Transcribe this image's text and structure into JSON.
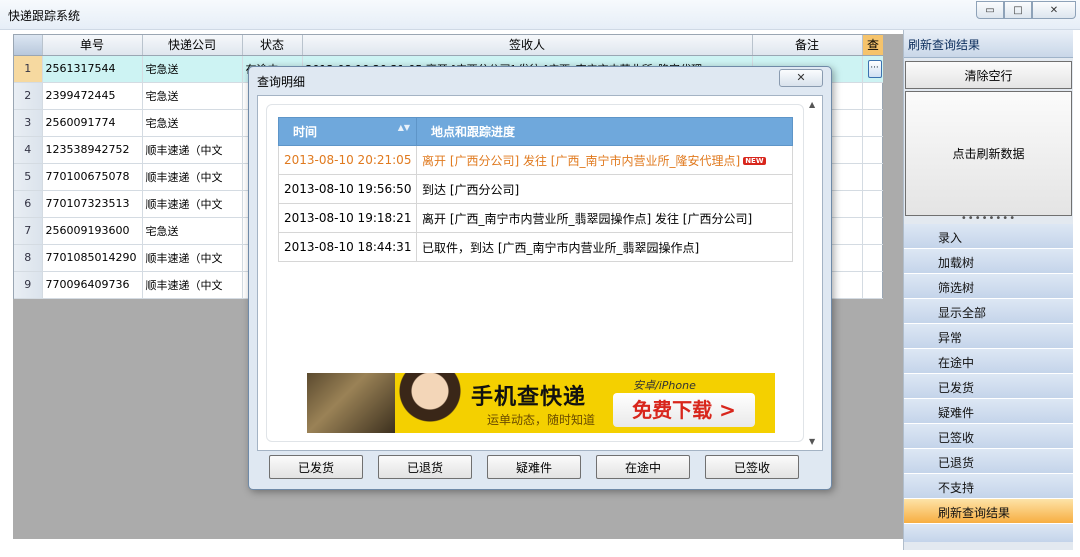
{
  "window": {
    "title": "快递跟踪系统",
    "min_glyph": "▭",
    "max_glyph": "□",
    "close_glyph": "✕"
  },
  "grid": {
    "columns": [
      "单号",
      "快递公司",
      "状态",
      "签收人",
      "备注",
      "查"
    ],
    "partial_status": "在途中",
    "partial_signer": "2013-08-10 20:21:05 离开 [广西分公司] 发往 [广西_南宁市内营业所_隆安代理",
    "more_glyph": "···",
    "rows": [
      {
        "n": "1",
        "id": "2561317544",
        "company": "宅急送"
      },
      {
        "n": "2",
        "id": "2399472445",
        "company": "宅急送"
      },
      {
        "n": "3",
        "id": "2560091774",
        "company": "宅急送"
      },
      {
        "n": "4",
        "id": "123538942752",
        "company": "顺丰速递（中文"
      },
      {
        "n": "5",
        "id": "770100675078",
        "company": "顺丰速递（中文"
      },
      {
        "n": "6",
        "id": "770107323513",
        "company": "顺丰速递（中文"
      },
      {
        "n": "7",
        "id": "256009193600",
        "company": "宅急送"
      },
      {
        "n": "8",
        "id": "7701085014290",
        "company": "顺丰速递（中文"
      },
      {
        "n": "9",
        "id": "770096409736",
        "company": "顺丰速递（中文"
      }
    ]
  },
  "right_panel": {
    "header": "刷新查询结果",
    "clear_btn": "清除空行",
    "refresh_btn": "点击刷新数据",
    "dots": "••••••••",
    "items": [
      "录入",
      "加载树",
      "筛选树",
      "显示全部",
      "异常",
      "在途中",
      "已发货",
      "疑难件",
      "已签收",
      "已退货",
      "不支持",
      "刷新查询结果"
    ],
    "active_item": "刷新查询结果"
  },
  "dialog": {
    "title": "查询明细",
    "close_glyph": "✕",
    "scroll_up": "▲",
    "scroll_down": "▼",
    "table": {
      "col_time": "时间",
      "col_place": "地点和跟踪进度",
      "sort_glyph": "▲▼",
      "rows": [
        {
          "time": "2013-08-10 20:21:05",
          "desc": "离开 [广西分公司] 发往 [广西_南宁市内营业所_隆安代理点]",
          "new": "NEW"
        },
        {
          "time": "2013-08-10 19:56:50",
          "desc": "到达 [广西分公司]"
        },
        {
          "time": "2013-08-10 19:18:21",
          "desc": "离开 [广西_南宁市内营业所_翡翠园操作点] 发往 [广西分公司]"
        },
        {
          "time": "2013-08-10 18:44:31",
          "desc": "已取件，到达 [广西_南宁市内营业所_翡翠园操作点]"
        }
      ]
    },
    "ad": {
      "headline": "手机查快递",
      "sub": "运单动态，随时知道",
      "platform": "安卓/iPhone",
      "download": "免费下载 >"
    },
    "buttons": [
      "已发货",
      "已退货",
      "疑难件",
      "在途中",
      "已签收"
    ]
  }
}
